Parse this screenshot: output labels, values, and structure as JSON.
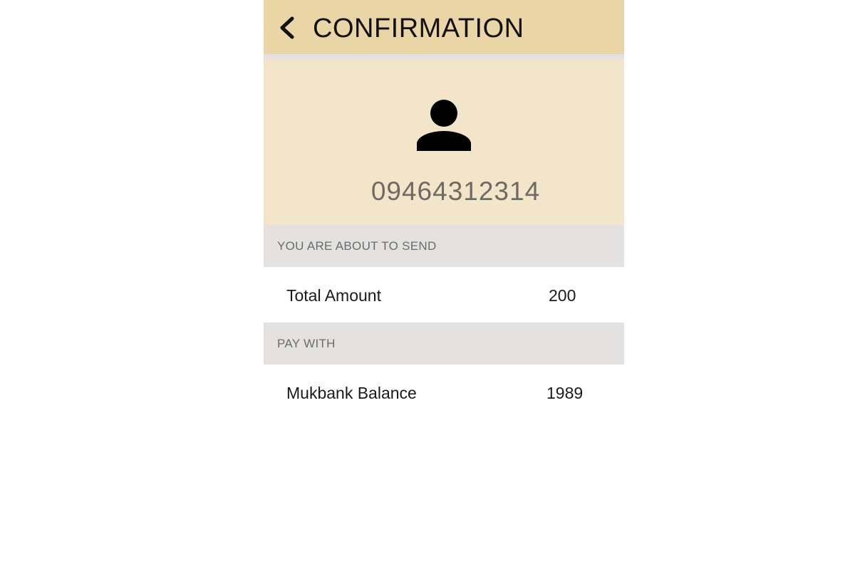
{
  "header": {
    "title": "CONFIRMATION",
    "back_icon": "chevron-left-icon"
  },
  "recipient": {
    "avatar_icon": "person-icon",
    "phone_number": "09464312314"
  },
  "send_section": {
    "header": "YOU ARE ABOUT TO SEND",
    "total_label": "Total Amount",
    "total_value": "200"
  },
  "pay_section": {
    "header": "PAY WITH",
    "balance_label": "Mukbank Balance",
    "balance_value": "1989"
  },
  "colors": {
    "appbar": "#ead5a6",
    "profile_bg": "#f3e5c9",
    "section_header_bg": "#e3e2e0"
  }
}
